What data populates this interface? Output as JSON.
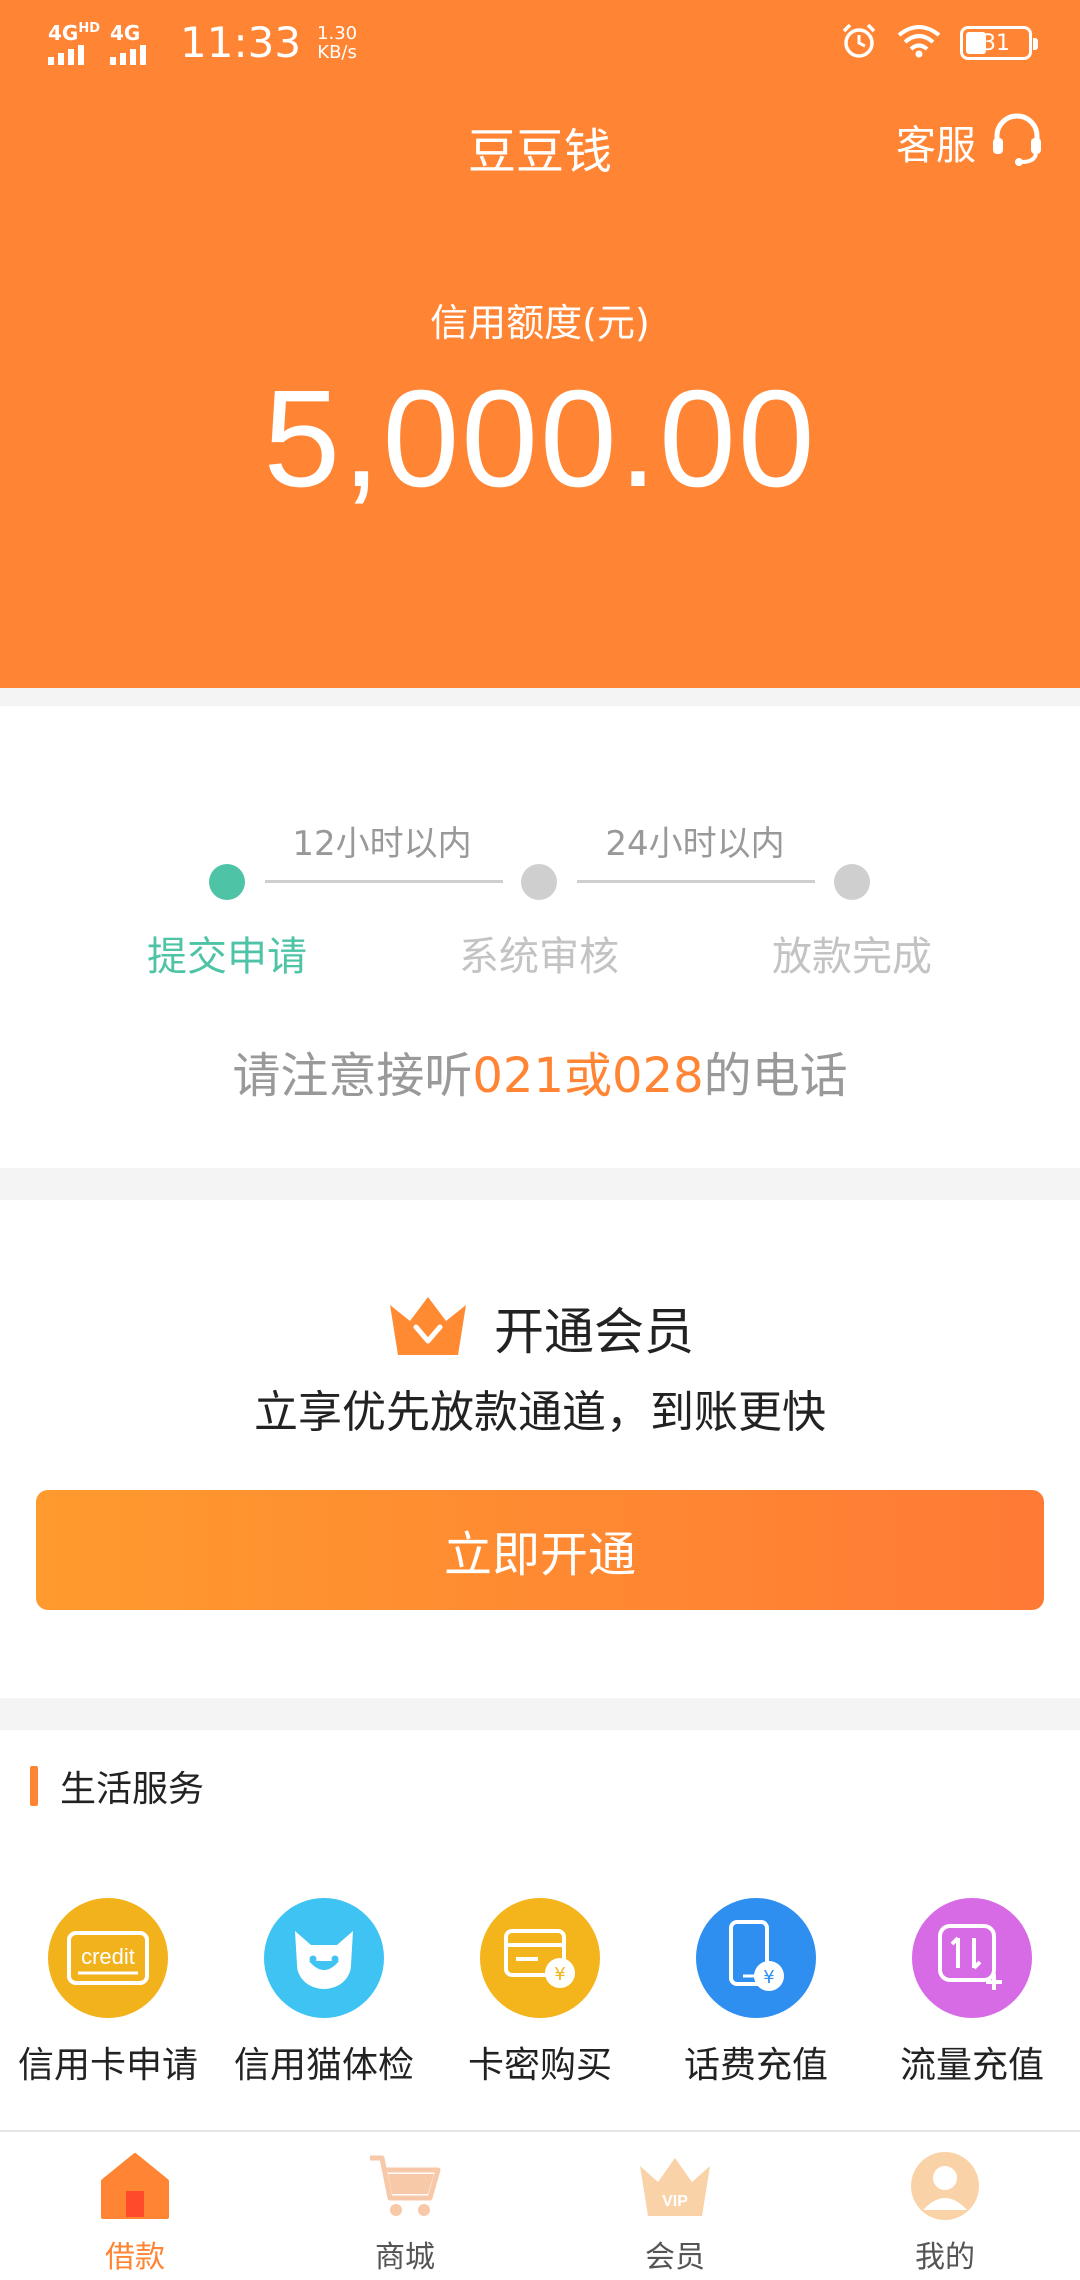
{
  "status_bar": {
    "net1": "4G",
    "net1_suffix": "HD",
    "net2": "4G",
    "time": "11:33",
    "speed_value": "1.30",
    "speed_unit": "KB/s",
    "battery": "31"
  },
  "header": {
    "title": "豆豆钱",
    "service_label": "客服",
    "credit_label": "信用额度(元)",
    "credit_amount": "5,000.00"
  },
  "progress": {
    "durations": [
      "12小时以内",
      "24小时以内"
    ],
    "steps": [
      {
        "label": "提交申请",
        "active": true
      },
      {
        "label": "系统审核",
        "active": false
      },
      {
        "label": "放款完成",
        "active": false
      }
    ],
    "notice_prefix": "请注意接听",
    "notice_highlight": "021或028",
    "notice_suffix": "的电话"
  },
  "member": {
    "title": "开通会员",
    "subtitle": "立享优先放款通道，到账更快",
    "button_label": "立即开通"
  },
  "life_services": {
    "title": "生活服务",
    "items": [
      {
        "label": "信用卡申请",
        "icon": "credit-card-icon",
        "icon_text": "credit",
        "color": "#f2b21c"
      },
      {
        "label": "信用猫体检",
        "icon": "cat-icon",
        "color": "#3fc3f2"
      },
      {
        "label": "卡密购买",
        "icon": "card-yuan-icon",
        "color": "#f3b51b"
      },
      {
        "label": "话费充值",
        "icon": "phone-yuan-icon",
        "color": "#2f8ff0"
      },
      {
        "label": "流量充值",
        "icon": "data-plus-icon",
        "color": "#d76be5"
      }
    ]
  },
  "tabbar": {
    "tabs": [
      {
        "label": "借款",
        "icon": "home-icon",
        "active": true
      },
      {
        "label": "商城",
        "icon": "cart-icon",
        "active": false
      },
      {
        "label": "会员",
        "icon": "crown-vip-icon",
        "icon_text": "VIP",
        "active": false
      },
      {
        "label": "我的",
        "icon": "avatar-icon",
        "active": false
      }
    ]
  },
  "colors": {
    "brand": "#ff8534",
    "accent_green": "#4ec3a6",
    "inactive_gray": "#cfcfcf"
  }
}
